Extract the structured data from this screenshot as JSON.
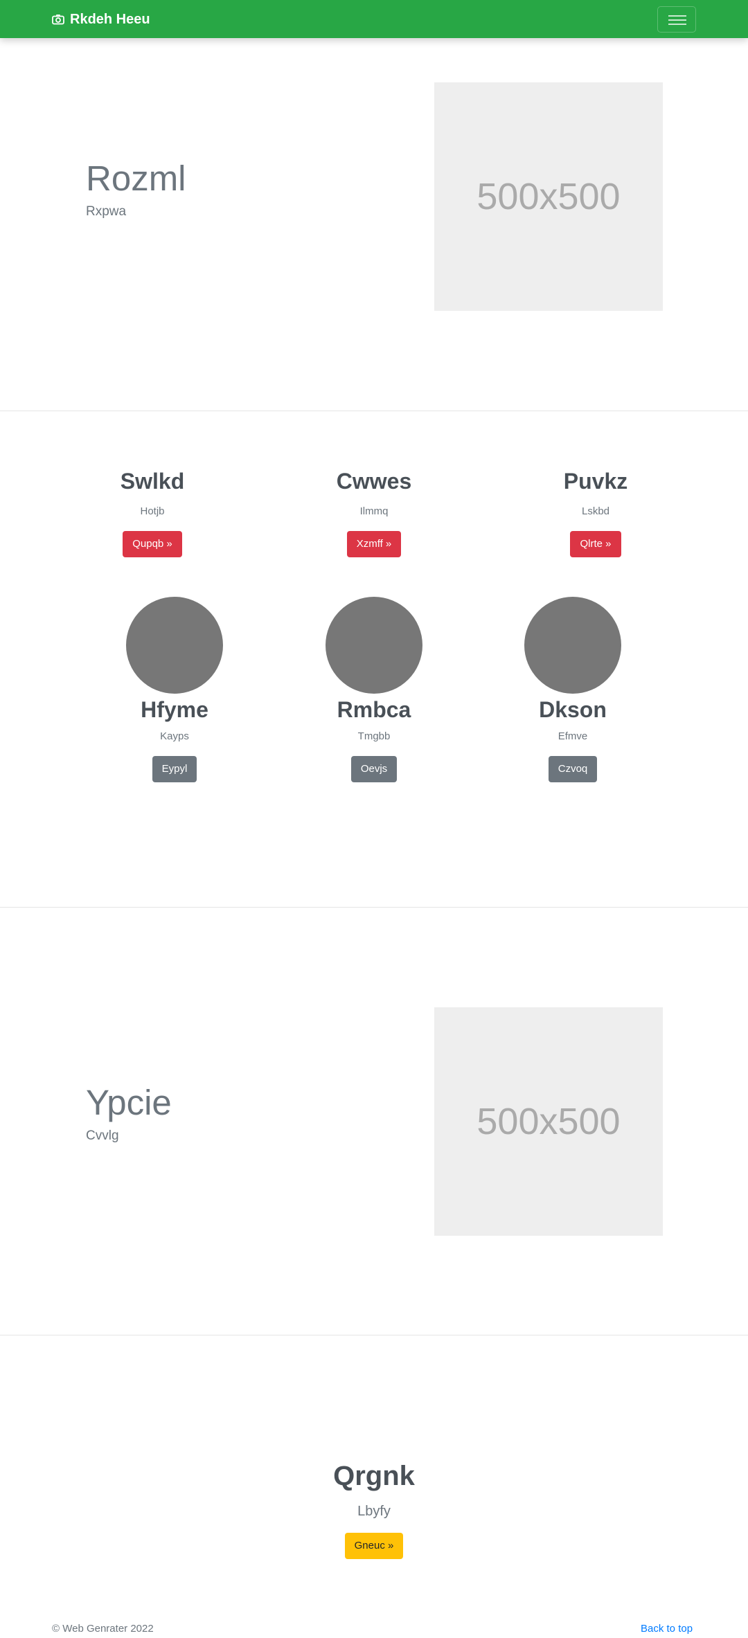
{
  "navbar": {
    "brand": "Rkdeh Heeu",
    "brand_icon": "camera-icon",
    "menu_icon": "hamburger-icon",
    "color": "#28a745"
  },
  "hero1": {
    "title": "Rozml",
    "subtitle": "Rxpwa",
    "image_text": "500x500"
  },
  "features": [
    {
      "title": "Swlkd",
      "subtitle": "Hotjb",
      "button": "Qupqb »"
    },
    {
      "title": "Cwwes",
      "subtitle": "Ilmmq",
      "button": "Xzmff »"
    },
    {
      "title": "Puvkz",
      "subtitle": "Lskbd",
      "button": "Qlrte »"
    }
  ],
  "people": [
    {
      "name": "Hfyme",
      "subtitle": "Kayps",
      "button": "Eypyl"
    },
    {
      "name": "Rmbca",
      "subtitle": "Tmgbb",
      "button": "Oevjs"
    },
    {
      "name": "Dkson",
      "subtitle": "Efmve",
      "button": "Czvoq"
    }
  ],
  "hero2": {
    "title": "Ypcie",
    "subtitle": "Cvvlg",
    "image_text": "500x500"
  },
  "cta": {
    "title": "Qrgnk",
    "subtitle": "Lbyfy",
    "button": "Gneuc »"
  },
  "footer": {
    "copyright": "© Web Genrater 2022",
    "back_to_top": "Back to top"
  },
  "colors": {
    "danger": "#dc3545",
    "secondary": "#6c757d",
    "warning": "#ffc107",
    "link": "#007bff"
  }
}
